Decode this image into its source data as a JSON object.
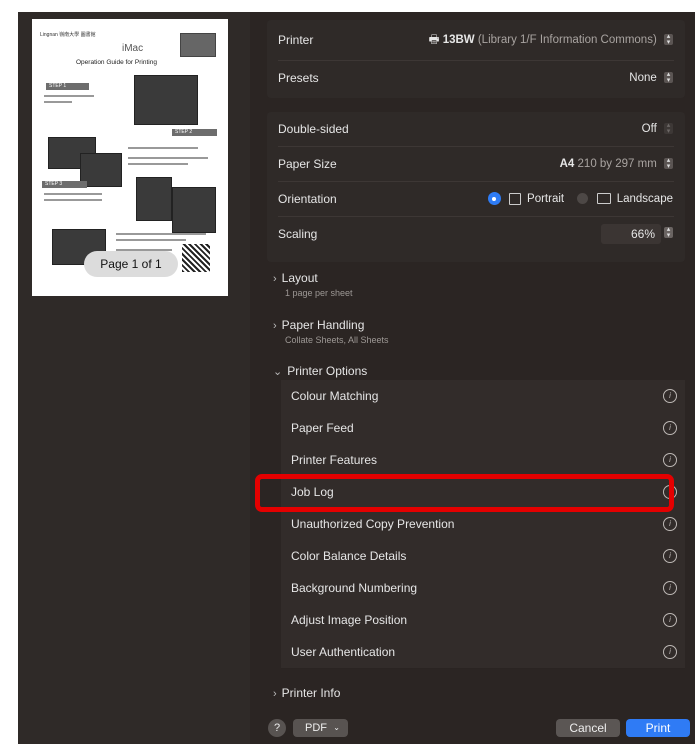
{
  "preview": {
    "page_badge": "Page 1 of 1",
    "doc_header": "Lingnan  嶺南大學   圖書館",
    "doc_product": "iMac",
    "doc_title": "Operation Guide for Printing",
    "step1": "STEP 1",
    "step2": "STEP 2",
    "step3": "STEP 3"
  },
  "printer": {
    "label": "Printer",
    "value_name": "13BW",
    "value_location": "(Library 1/F Information Commons)"
  },
  "presets": {
    "label": "Presets",
    "value": "None"
  },
  "double_sided": {
    "label": "Double-sided",
    "value": "Off"
  },
  "paper_size": {
    "label": "Paper Size",
    "value_name": "A4",
    "value_dims": "210 by 297 mm"
  },
  "orientation": {
    "label": "Orientation",
    "portrait": "Portrait",
    "landscape": "Landscape"
  },
  "scaling": {
    "label": "Scaling",
    "value": "66%"
  },
  "sections": {
    "layout": {
      "title": "Layout",
      "subtitle": "1 page per sheet"
    },
    "paper_handling": {
      "title": "Paper Handling",
      "subtitle": "Collate Sheets, All Sheets"
    },
    "printer_options": {
      "title": "Printer Options"
    },
    "printer_info": {
      "title": "Printer Info"
    }
  },
  "options": [
    "Colour Matching",
    "Paper Feed",
    "Printer Features",
    "Job Log",
    "Unauthorized Copy Prevention",
    "Color Balance Details",
    "Background Numbering",
    "Adjust Image Position",
    "User Authentication"
  ],
  "footer": {
    "help": "?",
    "pdf": "PDF",
    "cancel": "Cancel",
    "print": "Print"
  },
  "colors": {
    "accent": "#2f7bf5",
    "highlight": "#e40000",
    "background": "#2b2523"
  }
}
